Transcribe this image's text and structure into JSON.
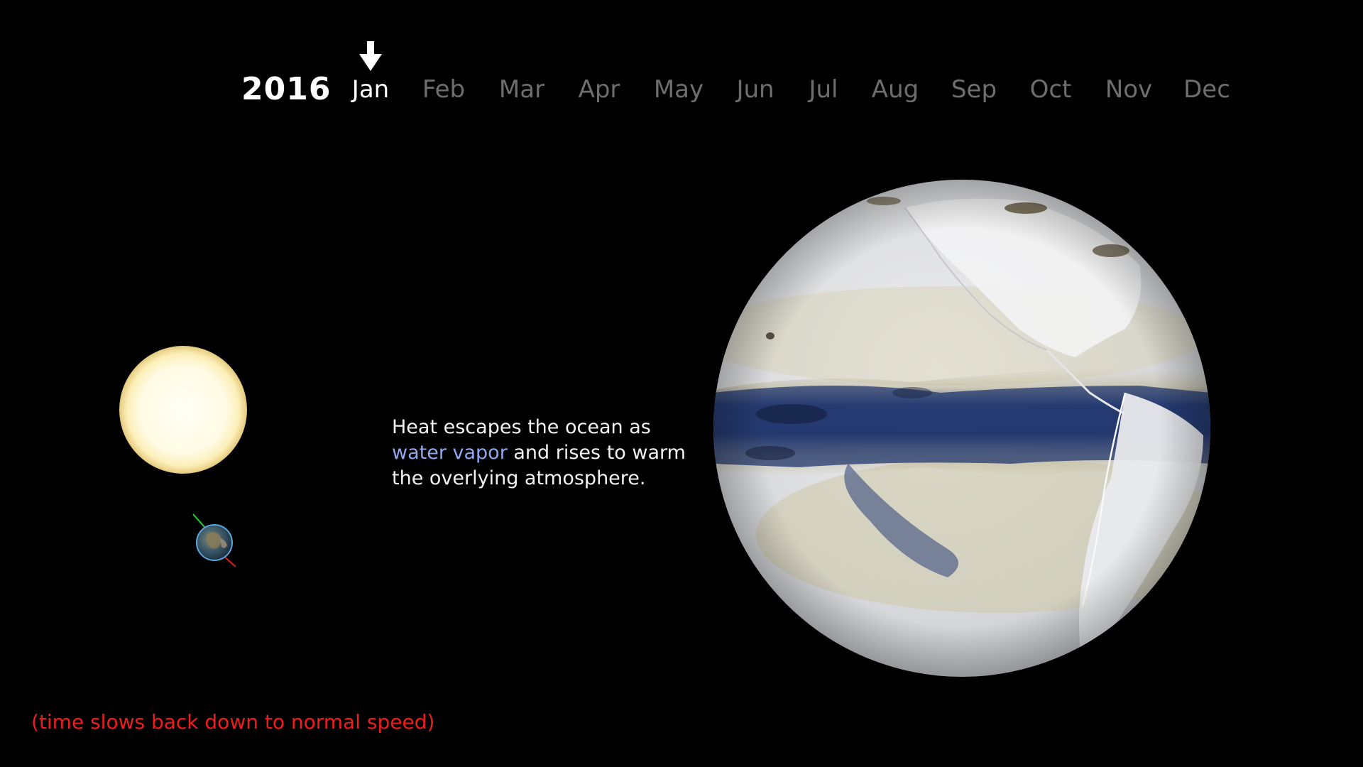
{
  "timeline": {
    "year": "2016",
    "months": [
      "Jan",
      "Feb",
      "Mar",
      "Apr",
      "May",
      "Jun",
      "Jul",
      "Aug",
      "Sep",
      "Oct",
      "Nov",
      "Dec"
    ],
    "active_month": "Jan"
  },
  "caption": {
    "line1": "Heat escapes the ocean as",
    "highlight": "water vapor",
    "line2_rest": " and rises to warm",
    "line3": "the overlying atmosphere."
  },
  "note": "(time slows back down to normal speed)",
  "colors": {
    "background": "#000000",
    "inactive_month": "#6e6e6e",
    "highlight": "#8fa8ee",
    "note": "#ee1c1c",
    "water_vapor": "#1e336e"
  },
  "icons": {
    "month_marker": "down-arrow-icon",
    "sun": "sun-icon",
    "small_earth": "earth-icon"
  }
}
